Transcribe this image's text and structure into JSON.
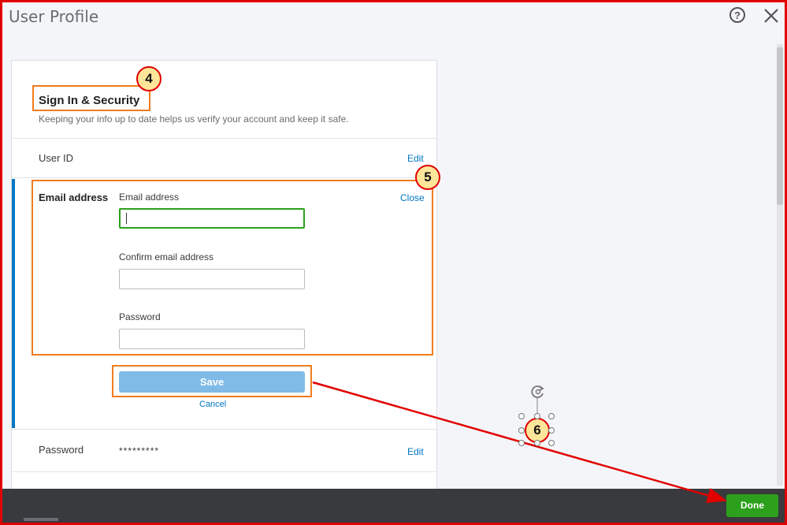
{
  "window": {
    "title": "User Profile"
  },
  "header": {
    "help_glyph": "?"
  },
  "section": {
    "title": "Sign In & Security",
    "subtitle": "Keeping your info up to date helps us verify your account and keep it safe."
  },
  "user_id": {
    "label": "User ID",
    "edit_label": "Edit"
  },
  "email": {
    "row_label": "Email address",
    "close_label": "Close",
    "email_field_label": "Email address",
    "email_value": "",
    "confirm_label": "Confirm email address",
    "confirm_value": "",
    "password_label": "Password",
    "password_value": "",
    "save_label": "Save",
    "cancel_label": "Cancel"
  },
  "password_row": {
    "label": "Password",
    "value": "*********",
    "edit_label": "Edit"
  },
  "footer": {
    "done_label": "Done"
  },
  "annotations": {
    "step4": "4",
    "step5": "5",
    "step6": "6"
  },
  "colors": {
    "link": "#0077c5",
    "done_green": "#2ca01c",
    "save_blue": "#7fbbe6",
    "highlight_orange": "#f07c1d",
    "annotation_red": "#e00000",
    "footer_dark": "#393a3d"
  }
}
